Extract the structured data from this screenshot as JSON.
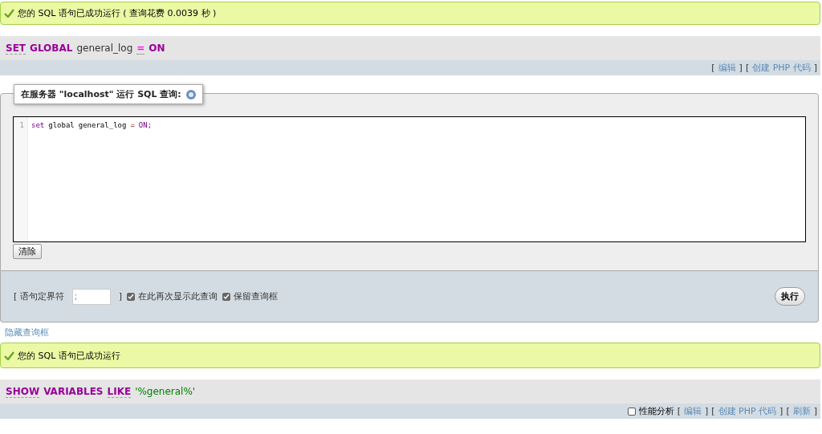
{
  "messages_top": {
    "text": "您的 SQL 语句已成功运行 ( 查询花费 0.0039 秒 )"
  },
  "query1": {
    "tokens": [
      {
        "kind": "keyword",
        "text": "SET",
        "underline": true
      },
      {
        "kind": "keyword",
        "text": "GLOBAL",
        "underline": false
      },
      {
        "kind": "plain",
        "text": "general_log",
        "underline": false
      },
      {
        "kind": "operator",
        "text": "=",
        "underline": true
      },
      {
        "kind": "keyword",
        "text": "ON",
        "underline": false
      }
    ],
    "actions": [
      {
        "left": "[",
        "label": "编辑",
        "right": "]"
      },
      {
        "left": "[",
        "label": "创建 PHP 代码",
        "right": "]"
      }
    ]
  },
  "sql_box": {
    "legend": "在服务器 \"localhost\" 运行 SQL 查询:",
    "line_number": "1",
    "code": [
      {
        "kind": "keyword",
        "text": "set"
      },
      {
        "kind": "plain",
        "text": "global"
      },
      {
        "kind": "plain",
        "text": "general_log"
      },
      {
        "kind": "operator",
        "text": "="
      },
      {
        "kind": "keyword",
        "text": "ON;"
      }
    ],
    "clear_button": "清除",
    "delimiter": {
      "left": "[ 语句定界符",
      "placeholder": ";",
      "right": "]"
    },
    "options": [
      {
        "label": "在此再次显示此查询",
        "checked": true
      },
      {
        "label": "保留查询框",
        "checked": true
      }
    ],
    "go_button": "执行"
  },
  "hide_link": "隐藏查询框",
  "message_second": {
    "text": "您的 SQL 语句已成功运行"
  },
  "query2": {
    "tokens": [
      {
        "kind": "keyword",
        "text": "SHOW",
        "underline": true
      },
      {
        "kind": "keyword",
        "text": "VARIABLES",
        "underline": false
      },
      {
        "kind": "keyword",
        "text": "LIKE",
        "underline": true
      },
      {
        "kind": "string",
        "text": "'%general%'",
        "underline": false
      }
    ],
    "profiling": {
      "label": "性能分析",
      "checked": false
    },
    "actions": [
      {
        "left": "[",
        "label": "编辑",
        "right": "]"
      },
      {
        "left": "[",
        "label": "创建 PHP 代码",
        "right": "]"
      },
      {
        "left": "[",
        "label": "刷新",
        "right": "]"
      }
    ]
  }
}
